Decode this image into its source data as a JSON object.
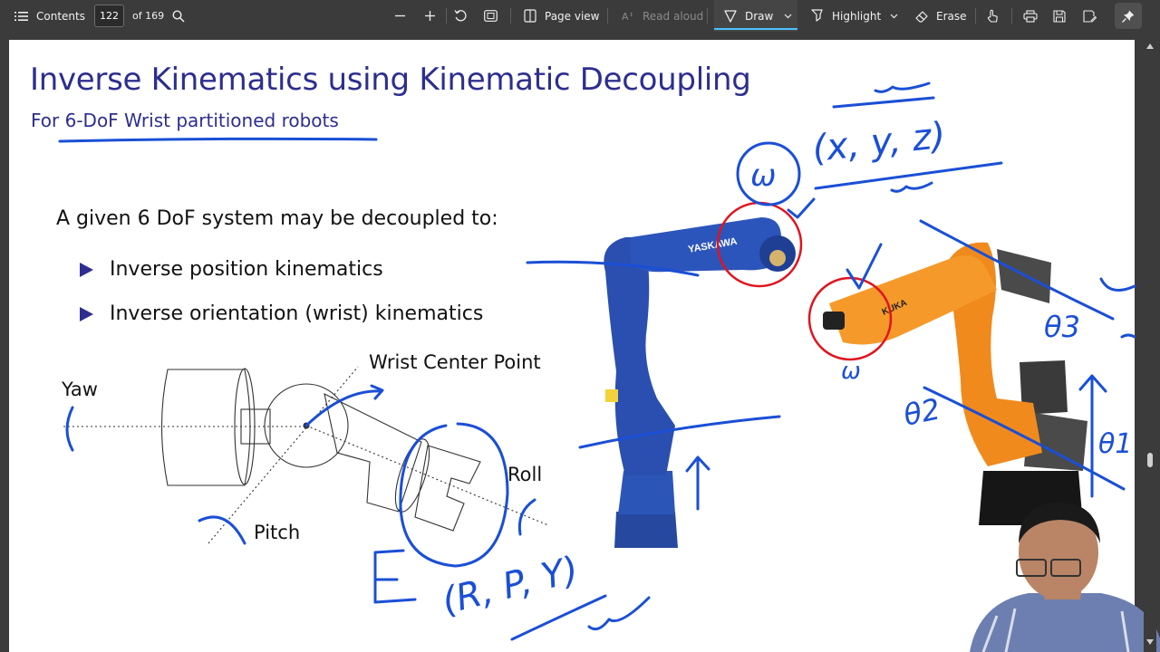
{
  "toolbar": {
    "contents_label": "Contents",
    "page_current": "122",
    "page_total": "of 169",
    "page_view_label": "Page view",
    "read_aloud_label": "Read aloud",
    "draw_label": "Draw",
    "highlight_label": "Highlight",
    "erase_label": "Erase",
    "icons": [
      "contents-icon",
      "search-icon",
      "zoom-out-icon",
      "zoom-in-icon",
      "rotate-icon",
      "fit-page-icon",
      "page-view-icon",
      "read-aloud-icon",
      "draw-icon",
      "highlight-icon",
      "erase-icon",
      "touch-icon",
      "print-icon",
      "save-icon",
      "save-as-icon",
      "pin-icon"
    ],
    "accent": "#4cc2ff"
  },
  "slide": {
    "title": "Inverse Kinematics using Kinematic Decoupling",
    "subtitle": "For 6-DoF Wrist partitioned robots",
    "intro": "A given 6 DoF system may be decoupled to:",
    "bullets": [
      "Inverse position kinematics",
      "Inverse orientation (wrist) kinematics"
    ],
    "diagram_labels": {
      "yaw": "Yaw",
      "wrist_center": "Wrist Center Point",
      "roll": "Roll",
      "pitch": "Pitch"
    },
    "robot_logos": {
      "blue": "YASKAWA",
      "orange": "KUKA"
    },
    "colors": {
      "title": "#2d2e8f",
      "ink": "#1a4fd6",
      "circle": "#e0141e",
      "robot_blue": "#2a4fb0",
      "robot_orange": "#f08a1c"
    }
  },
  "annotations": {
    "coords": "(x, y, z)",
    "omega": "ω",
    "angles": "(R, P, Y)",
    "theta1": "θ1",
    "theta2": "θ2",
    "theta3": "θ3"
  }
}
